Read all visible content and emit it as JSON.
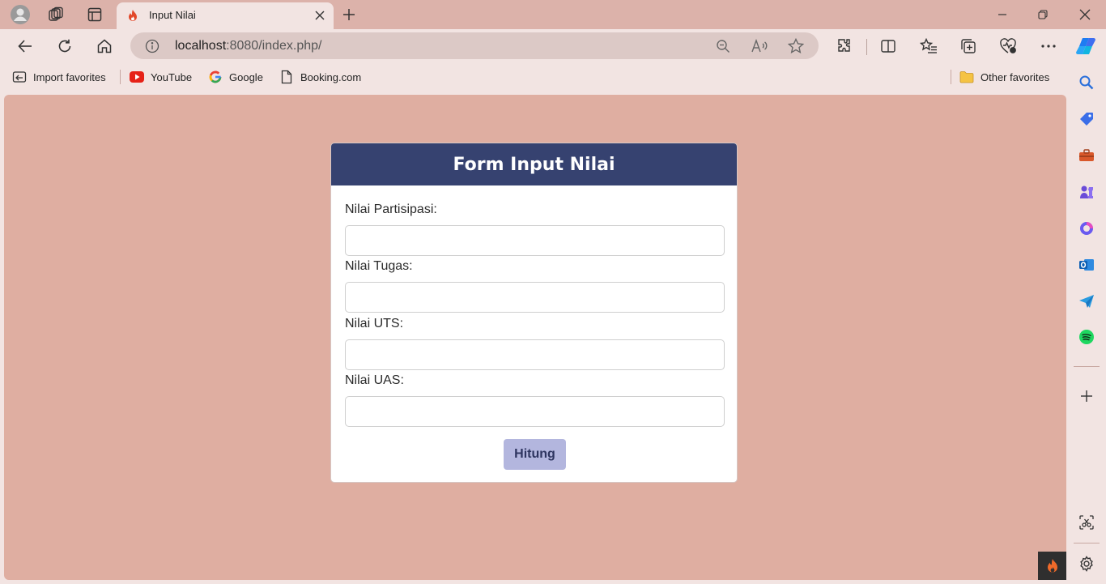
{
  "browser": {
    "tab": {
      "title": "Input Nilai"
    },
    "address": {
      "host": "localhost",
      "rest": ":8080/index.php/"
    },
    "bookmarks": [
      {
        "label": "Import favorites"
      },
      {
        "label": "YouTube"
      },
      {
        "label": "Google"
      },
      {
        "label": "Booking.com"
      }
    ],
    "other_favorites": "Other favorites"
  },
  "form": {
    "title": "Form Input Nilai",
    "fields": [
      {
        "label": "Nilai Partisipasi:",
        "value": "",
        "placeholder": ""
      },
      {
        "label": "Nilai Tugas:",
        "value": "",
        "placeholder": ""
      },
      {
        "label": "Nilai UTS:",
        "value": "",
        "placeholder": ""
      },
      {
        "label": "Nilai UAS:",
        "value": "",
        "placeholder": ""
      }
    ],
    "submit_label": "Hitung"
  },
  "colors": {
    "titlebar": "#dcb2aa",
    "page_bg": "#dfaea1",
    "header_bg": "#364270",
    "button_bg": "#b3b6de"
  }
}
